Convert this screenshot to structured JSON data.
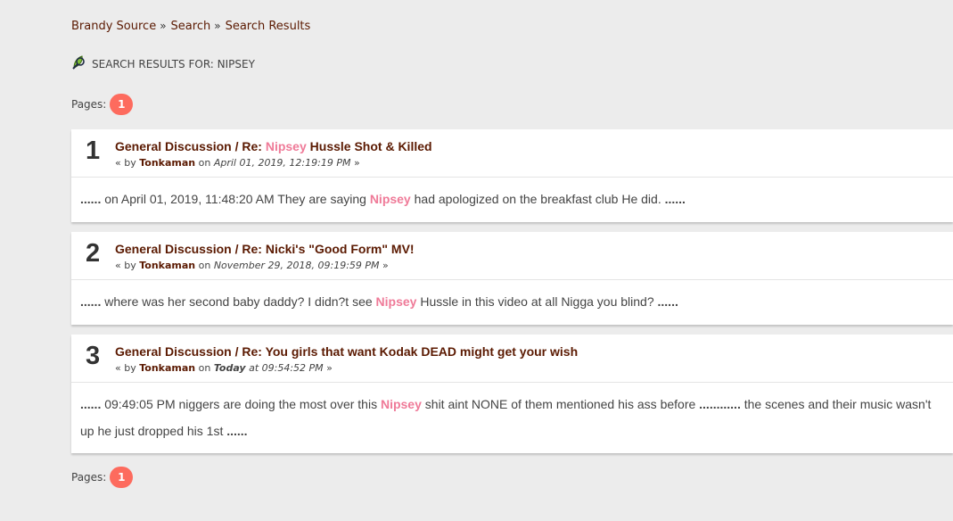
{
  "breadcrumb": {
    "items": [
      "Brandy Source",
      "Search",
      "Search Results"
    ],
    "separator": "»"
  },
  "results_header": {
    "title": "Search results for: nipsey",
    "icon": "search-results-icon"
  },
  "pagination": {
    "label": "Pages:",
    "current_page": "1"
  },
  "results": [
    {
      "number": "1",
      "topic_prefix": "General Discussion / Re: ",
      "topic_highlight": "Nipsey",
      "topic_suffix": " Hussle Shot & Killed",
      "meta_by": "« by",
      "author": "Tonkaman",
      "meta_on": "on",
      "date": "April 01, 2019, 12:19:19 PM",
      "meta_end": "»",
      "snippet_lead_dots": "......",
      "snippet_before": " on April 01, 2019, 11:48:20 AM  They are saying ",
      "snippet_highlight": "Nipsey",
      "snippet_after": " had apologized on the breakfast club   He did.  ",
      "snippet_trail_dots": "......"
    },
    {
      "number": "2",
      "topic_prefix": "General Discussion / Re: Nicki's \"Good Form\" MV!",
      "meta_by": "« by",
      "author": "Tonkaman",
      "meta_on": "on",
      "date": "November 29, 2018, 09:19:59 PM",
      "meta_end": "»",
      "snippet_lead_dots": "......",
      "snippet_before": " where was her second baby daddy? I didn?t see ",
      "snippet_highlight": "Nipsey",
      "snippet_after": " Hussle in this video at all    Nigga you blind?  ",
      "snippet_trail_dots": "......"
    },
    {
      "number": "3",
      "topic_prefix": "General Discussion / Re: You girls that want Kodak DEAD might get your wish",
      "meta_by": "« by",
      "author": "Tonkaman",
      "meta_on": "on",
      "date_today": "Today",
      "date_time": " at 09:54:52 PM",
      "meta_end": "»",
      "snippet_lead_dots": "......",
      "snippet_before": " 09:49:05 PM  niggers are doing the most over this ",
      "snippet_highlight": "Nipsey",
      "snippet_after": " shit aint NONE of them mentioned his ass before  ",
      "snippet_mid_dots": "............",
      "snippet_after2": "  the scenes and their music wasn't up he just dropped his 1st  ",
      "snippet_trail_dots": "......"
    }
  ],
  "colors": {
    "background": "#ececec",
    "link": "#5b1a02",
    "highlight": "#ef7a98",
    "page_badge": "#fd6b5e"
  }
}
